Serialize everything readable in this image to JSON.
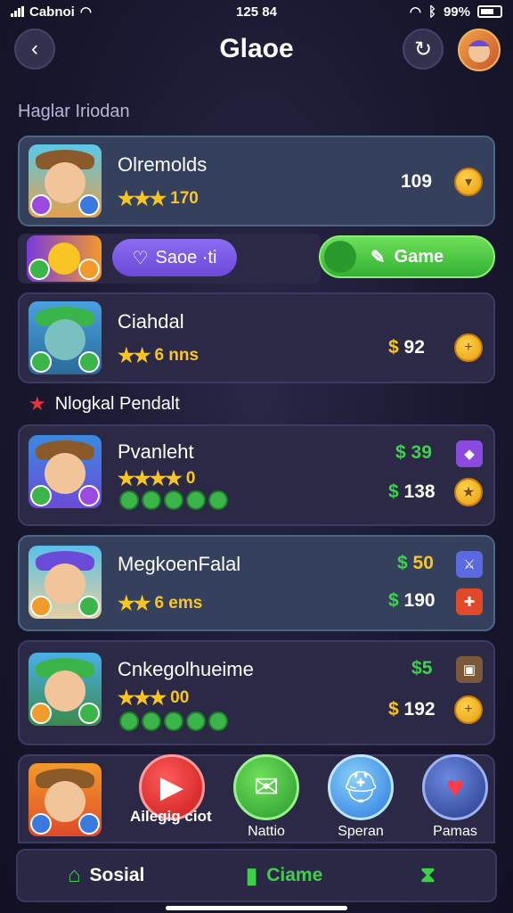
{
  "status_bar": {
    "carrier": "Cabnoi",
    "time": "125 84",
    "battery": "99%"
  },
  "header": {
    "title": "Glaoe"
  },
  "section1_title": "Haglar Iriodan",
  "section2_title": "Nlogkal Pendalt",
  "cards": [
    {
      "name": "Olremolds",
      "stars": "★★★",
      "rating": "170",
      "price": "109"
    },
    {
      "name": "Ciahdal",
      "stars": "★★",
      "rating": "6 nns",
      "currency": "$",
      "price": "92"
    },
    {
      "name": "Pvanleht",
      "stars": "★★★★",
      "rating": "0",
      "currency": "$",
      "price_top": "39",
      "price": "138"
    },
    {
      "name": "MegkoenFalal",
      "stars": "★★",
      "rating": "6 ems",
      "currency": "$",
      "price_top": "50",
      "price": "190"
    },
    {
      "name": "Cnkegolhueime",
      "stars": "★★★",
      "rating": "00",
      "currency": "$",
      "price_top": "5",
      "price": "192"
    }
  ],
  "actions": {
    "save_label": "Saoe ·ti",
    "game_label": "Game"
  },
  "tray": {
    "play_caption": "Ailegig ciot",
    "items": [
      "Nattio",
      "Speran",
      "Pamas"
    ]
  },
  "nav": {
    "social": "Sosial",
    "game": "Ciame"
  },
  "colors": {
    "accent_green": "#3bd44a",
    "accent_purple": "#7a5ae6",
    "gold": "#f8c624"
  }
}
